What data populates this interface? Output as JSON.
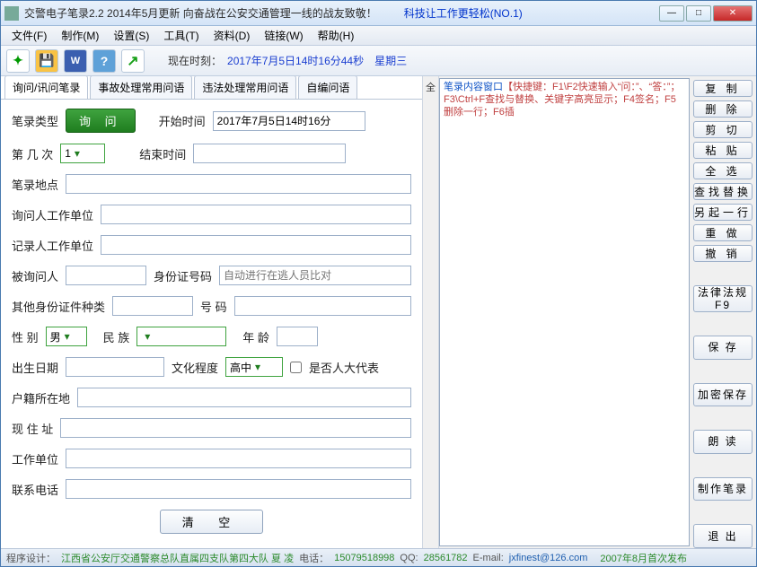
{
  "title": {
    "main": "交警电子笔录2.2 2014年5月更新 向奋战在公安交通管理一线的战友致敬！",
    "slogan": "科技让工作更轻松(NO.1)"
  },
  "menu": [
    "文件(F)",
    "制作(M)",
    "设置(S)",
    "工具(T)",
    "资料(D)",
    "链接(W)",
    "帮助(H)"
  ],
  "toolbar": {
    "clock_label": "现在时刻：",
    "clock_value": "2017年7月5日14时16分44秒",
    "clock_day": "星期三"
  },
  "tabs": [
    "询问/讯问笔录",
    "事故处理常用问语",
    "违法处理常用问语",
    "自编问语"
  ],
  "form": {
    "record_type_lbl": "笔录类型",
    "record_type_val": "询  问",
    "start_time_lbl": "开始时间",
    "start_time_val": "2017年7月5日14时16分",
    "times_lbl": "第 几 次",
    "times_val": "1",
    "end_time_lbl": "结束时间",
    "place_lbl": "笔录地点",
    "asker_unit_lbl": "询问人工作单位",
    "recorder_unit_lbl": "记录人工作单位",
    "asked_person_lbl": "被询问人",
    "id_lbl": "身份证号码",
    "id_placeholder": "自动进行在逃人员比对",
    "other_id_type_lbl": "其他身份证件种类",
    "number_lbl": "号   码",
    "sex_lbl": "性   别",
    "sex_val": "男",
    "nation_lbl": "民   族",
    "age_lbl": "年   龄",
    "birth_lbl": "出生日期",
    "edu_lbl": "文化程度",
    "edu_val": "高中",
    "deputy_lbl": "是否人大代表",
    "hometown_lbl": "户籍所在地",
    "address_lbl": "现 住 址",
    "work_unit_lbl": "工作单位",
    "phone_lbl": "联系电话",
    "clear_btn": "清  空"
  },
  "gutter": "全",
  "note_hint": {
    "a": "笔录内容窗口",
    "b": "【快捷键：F1\\F2快速输入“问：”、“答：”；F3\\Ctrl+F查找与替换、关键字高亮显示；F4签名；F5删除一行；F6插"
  },
  "side_buttons": {
    "copy": "复  制",
    "delete": "删  除",
    "cut": "剪  切",
    "paste": "粘  贴",
    "select_all": "全  选",
    "find": "查找替换",
    "newline": "另起一行",
    "redo": "重  做",
    "undo": "撤  销",
    "law": "法律法规",
    "law2": "F9",
    "save": "保  存",
    "enc_save": "加密保存",
    "read": "朗  读",
    "make": "制作笔录",
    "exit": "退  出"
  },
  "status": {
    "design_k": "程序设计：",
    "design_v": "江西省公安厅交通警察总队直属四支队第四大队 夏 凌",
    "tel_k": "电话：",
    "tel_v": "15079518998",
    "qq_k": "QQ:",
    "qq_v": "28561782",
    "mail_k": "E-mail:",
    "mail_v": "jxfinest@126.com",
    "date": "2007年8月首次发布"
  }
}
